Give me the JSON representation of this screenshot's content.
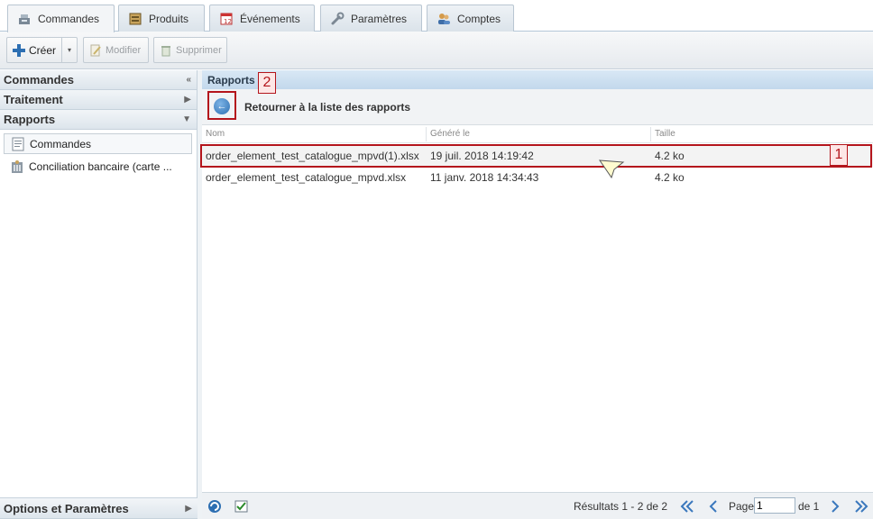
{
  "tabs": [
    {
      "label": "Commandes",
      "icon": "cash-register-icon",
      "active": true
    },
    {
      "label": "Produits",
      "icon": "products-icon",
      "active": false
    },
    {
      "label": "Événements",
      "icon": "calendar-icon",
      "active": false
    },
    {
      "label": "Paramètres",
      "icon": "wrench-icon",
      "active": false
    },
    {
      "label": "Comptes",
      "icon": "users-icon",
      "active": false
    }
  ],
  "toolbar": {
    "create_label": "Créer",
    "modify_label": "Modifier",
    "delete_label": "Supprimer"
  },
  "sidebar": {
    "sections": [
      {
        "label": "Commandes",
        "arrow": "«"
      },
      {
        "label": "Traitement",
        "arrow": "▶"
      },
      {
        "label": "Rapports",
        "arrow": "▼"
      }
    ],
    "items": [
      {
        "label": "Commandes"
      },
      {
        "label": "Conciliation bancaire (carte ..."
      }
    ],
    "bottom_label": "Options et Paramètres",
    "bottom_arrow": "▶"
  },
  "main": {
    "title": "Rapports",
    "back_label": "Retourner à la liste des rapports",
    "columns": [
      "Nom",
      "Généré le",
      "Taille"
    ],
    "rows": [
      {
        "name": "order_element_test_catalogue_mpvd(1).xlsx",
        "date": "19 juil. 2018 14:19:42",
        "size": "4.2 ko"
      },
      {
        "name": "order_element_test_catalogue_mpvd.xlsx",
        "date": "11 janv. 2018 14:34:43",
        "size": "4.2 ko"
      }
    ]
  },
  "pager": {
    "results": "Résultats 1 - 2 de 2",
    "page_label": "Page",
    "page_value": "1",
    "of_label": "de 1"
  },
  "annotations": {
    "one": "1",
    "two": "2"
  }
}
